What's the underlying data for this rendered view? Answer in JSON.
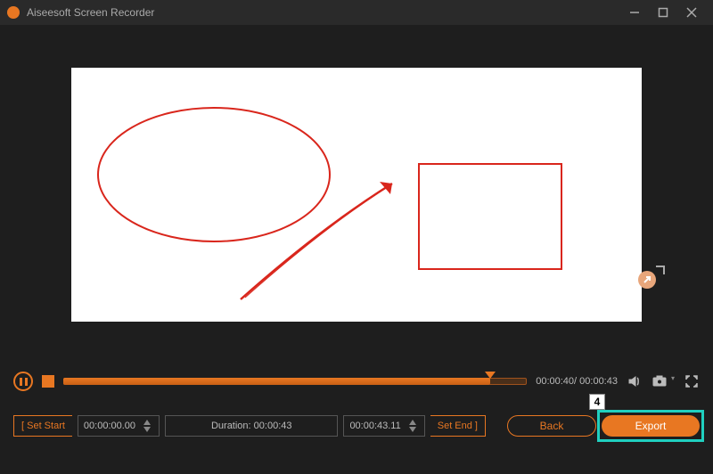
{
  "titlebar": {
    "title": "Aiseesoft Screen Recorder"
  },
  "player": {
    "current_time": "00:00:40",
    "total_time": "00:00:43"
  },
  "trim": {
    "set_start_label": "[ Set Start",
    "start_time": "00:00:00.00",
    "duration_label": "Duration:",
    "duration_value": "00:00:43",
    "end_time": "00:00:43.11",
    "set_end_label": "Set End ]"
  },
  "buttons": {
    "back": "Back",
    "export": "Export"
  },
  "annotation": {
    "step": "4"
  },
  "colors": {
    "accent": "#e87722",
    "highlight": "#20d0c0"
  }
}
